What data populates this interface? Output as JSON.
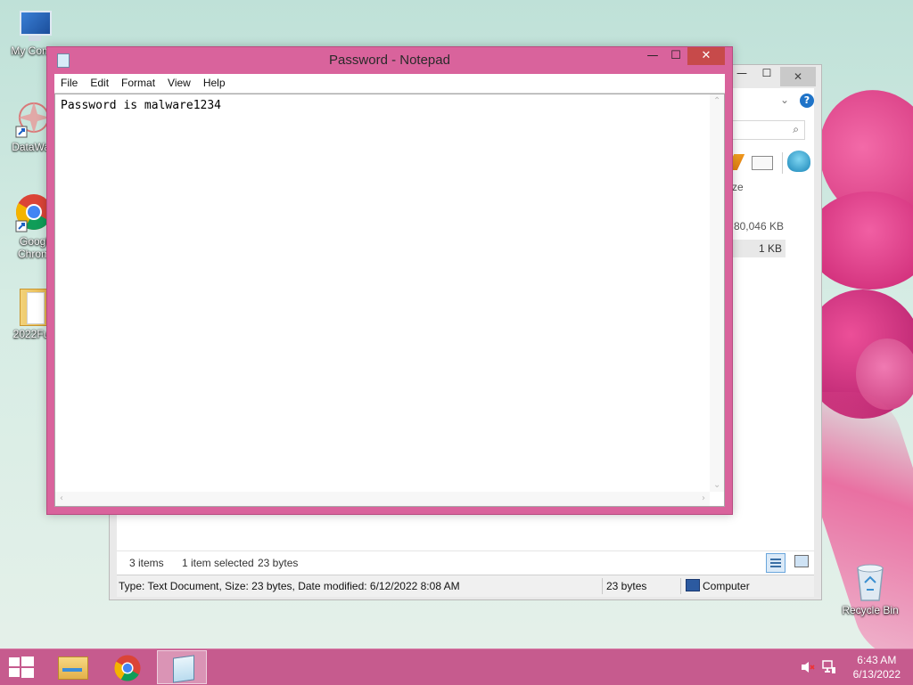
{
  "desktop": {
    "icons": [
      {
        "label": "My Comp"
      },
      {
        "label": "DataWag"
      },
      {
        "label": "Googl Chrom"
      },
      {
        "label": "2022Fuc"
      }
    ],
    "recycle_bin": {
      "label": "Recycle Bin"
    }
  },
  "notepad": {
    "title": "Password - Notepad",
    "menu": [
      "File",
      "Edit",
      "Format",
      "View",
      "Help"
    ],
    "content": "Password is malware1234",
    "controls": {
      "minimize": "—",
      "maximize": "☐",
      "close": "✕"
    }
  },
  "explorer": {
    "file_sizes": [
      "80,046 KB",
      "1 KB"
    ],
    "partial_label": "ze",
    "status": {
      "items": "3 items",
      "selected": "1 item selected",
      "selected_size": "23 bytes",
      "detail": "Type: Text Document, Size: 23 bytes, Date modified: 6/12/2022 8:08 AM",
      "size": "23 bytes",
      "location": "Computer"
    }
  },
  "taskbar": {
    "time": "6:43 AM",
    "date": "6/13/2022"
  },
  "colors": {
    "notepad_frame": "#d9639c",
    "taskbar": "#c65b8e",
    "close_button": "#c74a4a"
  }
}
